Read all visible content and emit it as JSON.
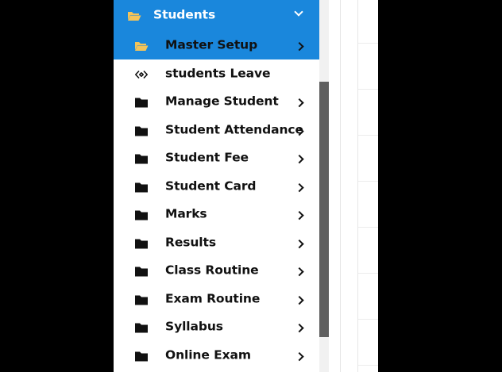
{
  "sidebar": {
    "header": {
      "label": "Students",
      "icon": "folder-open-icon",
      "expanded": true
    },
    "items": [
      {
        "label": "Master Setup",
        "icon": "folder-open-icon",
        "active": true,
        "has_submenu": true
      },
      {
        "label": "students Leave",
        "icon": "link-icon",
        "active": false,
        "has_submenu": false
      },
      {
        "label": "Manage Student",
        "icon": "folder-icon",
        "active": false,
        "has_submenu": true
      },
      {
        "label": "Student Attendance",
        "icon": "folder-icon",
        "active": false,
        "has_submenu": true
      },
      {
        "label": "Student Fee",
        "icon": "folder-icon",
        "active": false,
        "has_submenu": true
      },
      {
        "label": "Student Card",
        "icon": "folder-icon",
        "active": false,
        "has_submenu": true
      },
      {
        "label": "Marks",
        "icon": "folder-icon",
        "active": false,
        "has_submenu": true
      },
      {
        "label": "Results",
        "icon": "folder-icon",
        "active": false,
        "has_submenu": true
      },
      {
        "label": "Class Routine",
        "icon": "folder-icon",
        "active": false,
        "has_submenu": true
      },
      {
        "label": "Exam Routine",
        "icon": "folder-icon",
        "active": false,
        "has_submenu": true
      },
      {
        "label": "Syllabus",
        "icon": "folder-icon",
        "active": false,
        "has_submenu": true
      },
      {
        "label": "Online Exam",
        "icon": "folder-icon",
        "active": false,
        "has_submenu": true
      }
    ]
  },
  "colors": {
    "accent": "#1a87dc",
    "folder_open": "#f4c45a",
    "text": "#111111",
    "scroll_thumb": "#5f5f5f"
  }
}
